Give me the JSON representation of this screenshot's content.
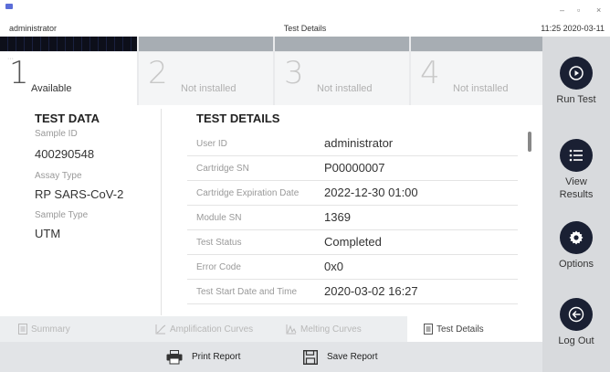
{
  "window": {
    "user": "administrator",
    "title": "Test Details",
    "datetime": "11:25 2020-03-11",
    "minimize": "–",
    "maximize": "▫",
    "close": "×"
  },
  "modules": [
    {
      "number": "1",
      "label": "Available",
      "indicator": "···"
    },
    {
      "number": "2",
      "label": "Not installed"
    },
    {
      "number": "3",
      "label": "Not installed"
    },
    {
      "number": "4",
      "label": "Not installed"
    }
  ],
  "sidebar": {
    "run_test": "Run Test",
    "view_results_line1": "View",
    "view_results_line2": "Results",
    "options": "Options",
    "log_out": "Log Out"
  },
  "test_data": {
    "heading": "TEST DATA",
    "sample_id_label": "Sample ID",
    "sample_id": "400290548",
    "assay_type_label": "Assay Type",
    "assay_type": "RP SARS-CoV-2",
    "sample_type_label": "Sample Type",
    "sample_type": "UTM"
  },
  "test_details": {
    "heading": "TEST DETAILS",
    "rows": [
      {
        "label": "User ID",
        "value": "administrator"
      },
      {
        "label": "Cartridge SN",
        "value": "P00000007"
      },
      {
        "label": "Cartridge Expiration Date",
        "value": "2022-12-30 01:00"
      },
      {
        "label": "Module SN",
        "value": "1369"
      },
      {
        "label": "Test Status",
        "value": "Completed"
      },
      {
        "label": "Error Code",
        "value": "0x0"
      },
      {
        "label": "Test Start Date and Time",
        "value": "2020-03-02 16:27"
      }
    ]
  },
  "tabs": {
    "summary": "Summary",
    "amplification": "Amplification Curves",
    "melting": "Melting Curves",
    "details": "Test Details"
  },
  "footer": {
    "print": "Print Report",
    "save": "Save Report"
  },
  "colors": {
    "sidebar_button": "#1a2033",
    "strip_dark": "#0d0f1a",
    "strip_grey": "#a7adb3"
  }
}
